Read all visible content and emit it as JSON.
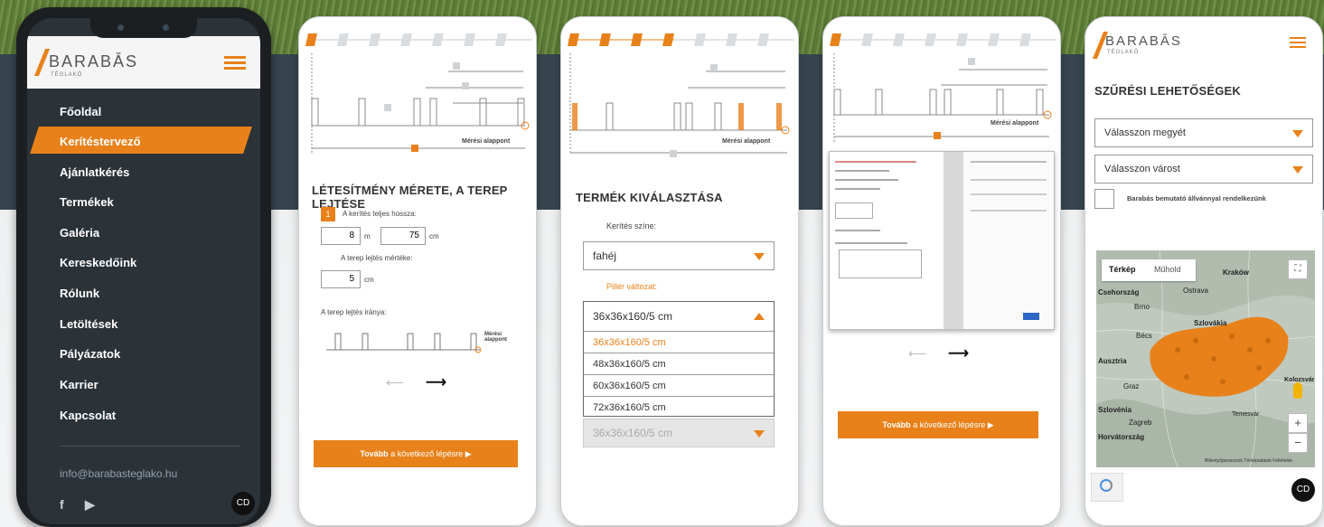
{
  "menu_phone": {
    "logo": "BARABĀS",
    "logo_sub": "TÉGLAKŐ",
    "items": [
      "Főoldal",
      "Kerítéstervező",
      "Ajánlatkérés",
      "Termékek",
      "Galéria",
      "Kereskedőink",
      "Rólunk",
      "Letöltések",
      "Pályázatok",
      "Karrier",
      "Kapcsolat"
    ],
    "active_item": "Kerítéstervező",
    "email": "info@barabasteglako.hu",
    "social": [
      "f",
      "▶"
    ],
    "cookie": "CD"
  },
  "phone2": {
    "steps_active": 1,
    "measure_label": "Mérési alappont",
    "title": "LÉTESÍTMÉNY MÉRETE, A TEREP LEJTÉSE",
    "step_num": "1",
    "length_label": "A kerítés teljes hossza:",
    "length_m": "8",
    "unit_m": "m",
    "length_cm": "75",
    "unit_cm": "cm",
    "slope_label": "A terep lejtés mértéke:",
    "slope_value": "5",
    "slope_unit": "cm",
    "direction_label": "A terep lejtés iránya:",
    "dir_measure_label": "Mérési alappont",
    "next_bold": "Tovább",
    "next_rest": " a következő lépésre"
  },
  "phone3": {
    "steps_active": 4,
    "measure_label": "Mérési alappont",
    "title": "TERMÉK KIVÁLASZTÁSA",
    "color_label": "Kerítés színe:",
    "color_value": "fahéj",
    "pillar_label": "Pillér változat:",
    "pillar_value": "36x36x160/5 cm",
    "options": [
      "36x36x160/5 cm",
      "48x36x160/5 cm",
      "60x36x160/5 cm",
      "72x36x160/5 cm"
    ],
    "disabled_value": "36x36x160/5 cm"
  },
  "phone4": {
    "steps_active": 1,
    "measure_label": "Mérési alappont",
    "next_bold": "Tovább",
    "next_rest": " a következő lépésre"
  },
  "phone5": {
    "logo": "BARABĀS",
    "logo_sub": "TÉGLAKŐ",
    "title": "SZŰRÉSI LEHETŐSÉGEK",
    "county_placeholder": "Válasszon megyét",
    "city_placeholder": "Válasszon várost",
    "checkbox_label": "Barabás bemutató állvánnyal rendelkezünk",
    "map_tab_map": "Térkép",
    "map_tab_sat": "Műhold",
    "map_labels": [
      "Csehország",
      "Kraków",
      "Brno",
      "Ostrava",
      "Szlovákia",
      "Bécs",
      "Ausztria",
      "Graz",
      "Szlovénia",
      "Zagreb",
      "Horvátország",
      "Kolozsvár",
      "Temesvár"
    ],
    "map_footer": [
      "Billentyűparancsok",
      "Térképadatok",
      "Feltételek"
    ],
    "cookie": "CD",
    "colors": {
      "accent": "#e8811a"
    }
  }
}
